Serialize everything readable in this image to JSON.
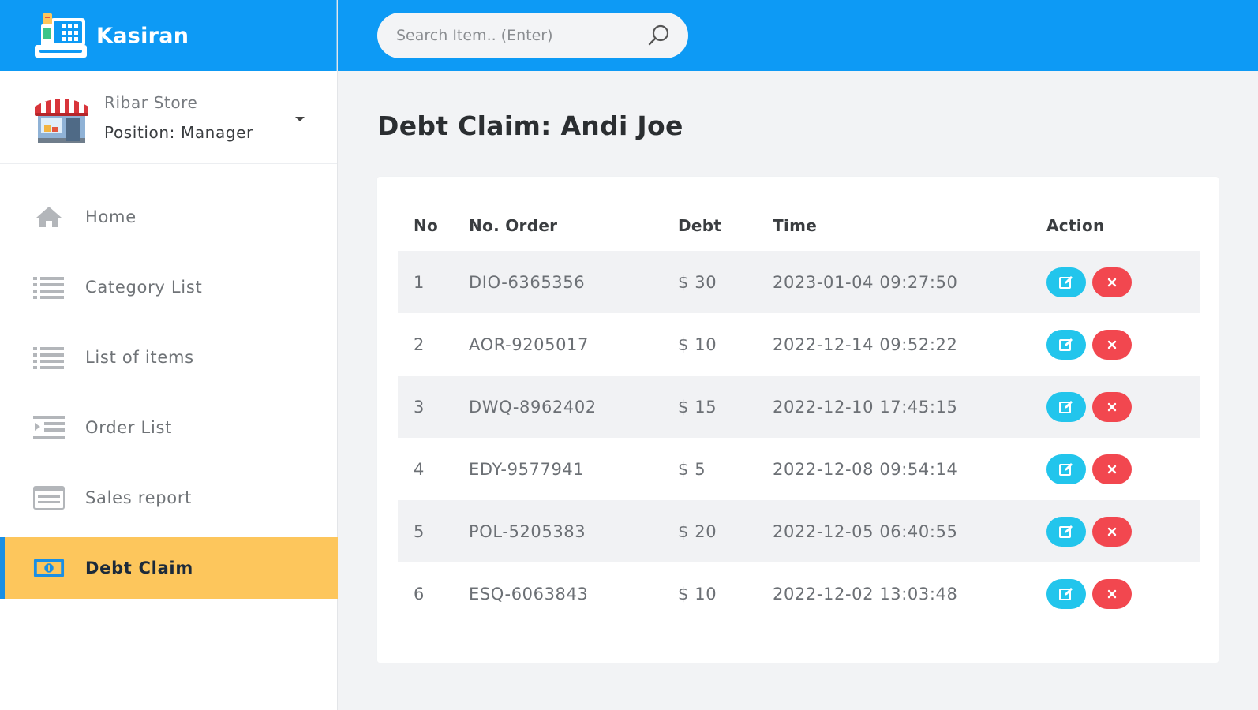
{
  "app": {
    "name": "Kasiran"
  },
  "store": {
    "name": "Ribar Store",
    "position": "Position: Manager"
  },
  "search": {
    "placeholder": "Search Item.. (Enter)"
  },
  "sidebar": {
    "items": [
      {
        "label": "Home",
        "icon": "home-icon"
      },
      {
        "label": "Category List",
        "icon": "list-icon"
      },
      {
        "label": "List of items",
        "icon": "list-icon"
      },
      {
        "label": "Order List",
        "icon": "order-list-icon"
      },
      {
        "label": "Sales report",
        "icon": "report-icon"
      },
      {
        "label": "Debt Claim",
        "icon": "money-icon",
        "active": true
      }
    ]
  },
  "page": {
    "title": "Debt Claim: Andi Joe"
  },
  "table": {
    "headers": [
      "No",
      "No. Order",
      "Debt",
      "Time",
      "Action"
    ],
    "rows": [
      {
        "no": "1",
        "order": "DIO-6365356",
        "debt": "$ 30",
        "time": "2023-01-04 09:27:50"
      },
      {
        "no": "2",
        "order": "AOR-9205017",
        "debt": "$ 10",
        "time": "2022-12-14 09:52:22"
      },
      {
        "no": "3",
        "order": "DWQ-8962402",
        "debt": "$ 15",
        "time": "2022-12-10 17:45:15"
      },
      {
        "no": "4",
        "order": "EDY-9577941",
        "debt": "$ 5",
        "time": "2022-12-08 09:54:14"
      },
      {
        "no": "5",
        "order": "POL-5205383",
        "debt": "$ 20",
        "time": "2022-12-05 06:40:55"
      },
      {
        "no": "6",
        "order": "ESQ-6063843",
        "debt": "$ 10",
        "time": "2022-12-02 13:03:48"
      }
    ]
  },
  "colors": {
    "header": "#0d9af5",
    "active_nav": "#fdc65c",
    "edit": "#22c5ec",
    "delete": "#f2474f"
  }
}
